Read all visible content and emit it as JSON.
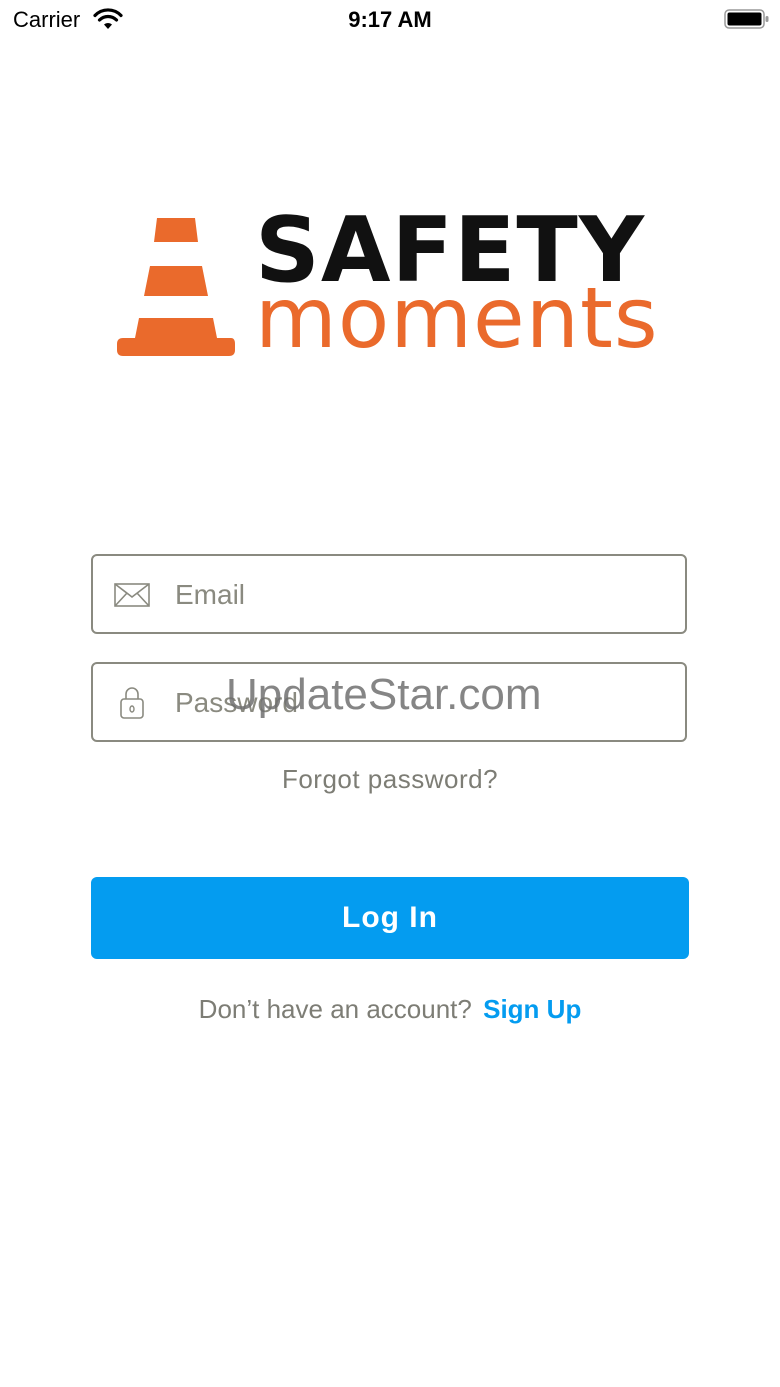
{
  "status_bar": {
    "carrier": "Carrier",
    "time": "9:17 AM"
  },
  "logo": {
    "line1": "SAFETY",
    "line2": "moments",
    "colors": {
      "cone": "#ea6a2c",
      "dark": "#111111"
    }
  },
  "email_field": {
    "placeholder": "Email",
    "icon": "envelope-icon"
  },
  "password_field": {
    "placeholder": "Password",
    "icon": "lock-icon"
  },
  "watermark": "UpdateStar.com",
  "forgot_password": "Forgot password?",
  "login_button": {
    "label": "Log In",
    "color": "#049cf0"
  },
  "signup": {
    "prompt": "Don’t have an account?",
    "link": "Sign Up"
  }
}
